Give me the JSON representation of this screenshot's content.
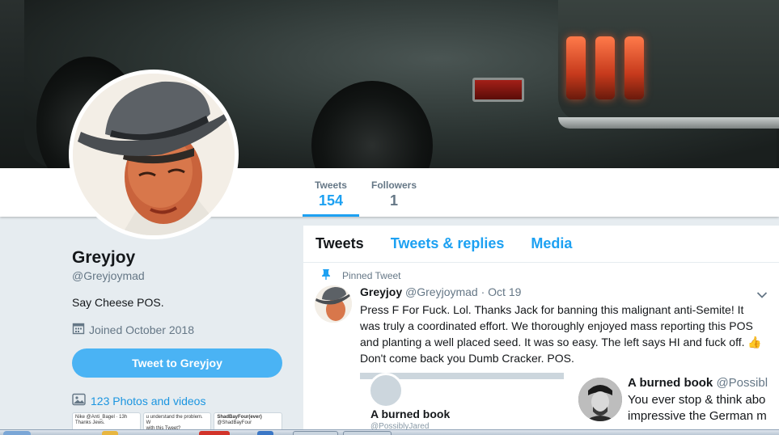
{
  "nav": {
    "stats": [
      {
        "label": "Tweets",
        "value": "154",
        "active": true
      },
      {
        "label": "Followers",
        "value": "1",
        "active": false
      }
    ]
  },
  "profile": {
    "name": "Greyjoy",
    "handle": "@Greyjoymad",
    "bio": "Say Cheese POS.",
    "joined": "Joined October 2018",
    "tweet_to_button": "Tweet to Greyjoy",
    "photos_link": "123 Photos and videos",
    "thumbs": [
      {
        "line1": "Nike @Anti_Bagel · 13h",
        "line2": "Thanks Jews."
      },
      {
        "line1": "u understand the problem. W",
        "line2": "with this Tweet?"
      },
      {
        "line1": "ShadBayFour(ever)",
        "line2": "@ShadBayFour"
      }
    ]
  },
  "timeline": {
    "tabs": [
      {
        "label": "Tweets",
        "active": true
      },
      {
        "label": "Tweets & replies",
        "active": false
      },
      {
        "label": "Media",
        "active": false
      }
    ],
    "pinned_label": "Pinned Tweet",
    "tweet": {
      "name": "Greyjoy",
      "handle": "@Greyjoymad",
      "date": "· Oct 19",
      "text": "Press F For Fuck. Lol. Thanks Jack for banning this malignant anti-Semite! It was truly a coordinated effort. We thoroughly enjoyed mass reporting this POS and planting a well placed seed. It was so easy. The left says HI and fuck off. 👍Don't come back you Dumb Cracker. POS."
    },
    "quote_left": {
      "title": "A burned book",
      "handle": "@PossiblyJared"
    },
    "quote_right": {
      "name": "A burned book",
      "handle": "@Possibl",
      "body": "You ever stop & think abo impressive the German m"
    }
  },
  "colors": {
    "accent": "#1da1f2",
    "button": "#4ab3f4",
    "background": "#e6ecf0",
    "muted": "#657786"
  },
  "icons": {
    "calendar": "calendar-icon",
    "photos": "photo-icon",
    "pin": "pin-icon",
    "caret": "chevron-down-icon"
  }
}
